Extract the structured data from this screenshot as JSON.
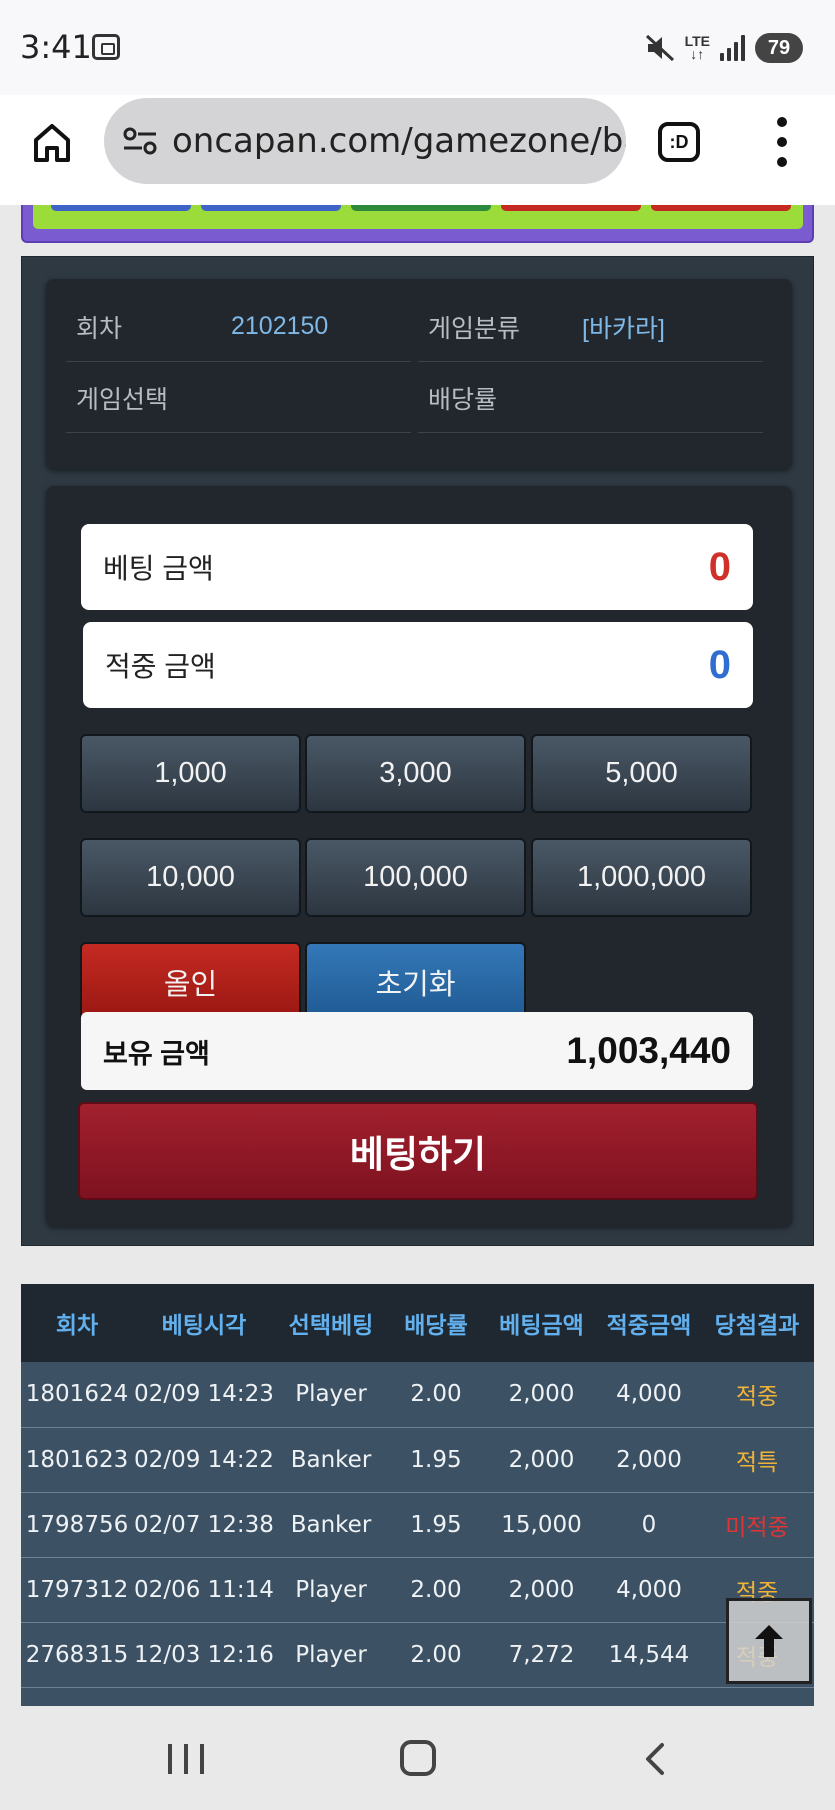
{
  "status_bar": {
    "time": "3:41",
    "battery": "79",
    "network": "LTE"
  },
  "browser": {
    "url": "oncapan.com/gamezone/ba",
    "tab_label": ":D"
  },
  "info": {
    "round_label": "회차",
    "round_value": "2102150",
    "category_label": "게임분류",
    "category_value": "[바카라]",
    "select_label": "게임선택",
    "odds_label": "배당률"
  },
  "bet": {
    "bet_amount_label": "베팅 금액",
    "bet_amount_value": "0",
    "win_amount_label": "적중 금액",
    "win_amount_value": "0",
    "chips": [
      "1,000",
      "3,000",
      "5,000",
      "10,000",
      "100,000",
      "1,000,000"
    ],
    "allin_label": "올인",
    "reset_label": "초기화",
    "balance_label": "보유 금액",
    "balance_value": "1,003,440",
    "submit_label": "베팅하기"
  },
  "history": {
    "headers": [
      "회차",
      "베팅시각",
      "선택베팅",
      "배당률",
      "베팅금액",
      "적중금액",
      "당첨결과"
    ],
    "rows": [
      [
        "1801624",
        "02/09 14:23",
        "Player",
        "2.00",
        "2,000",
        "4,000",
        "적중"
      ],
      [
        "1801623",
        "02/09 14:22",
        "Banker",
        "1.95",
        "2,000",
        "2,000",
        "적특"
      ],
      [
        "1798756",
        "02/07 12:38",
        "Banker",
        "1.95",
        "15,000",
        "0",
        "미적중"
      ],
      [
        "1797312",
        "02/06 11:14",
        "Player",
        "2.00",
        "2,000",
        "4,000",
        "적중"
      ],
      [
        "2768315",
        "12/03 12:16",
        "Player",
        "2.00",
        "7,272",
        "14,544",
        "적중"
      ]
    ]
  },
  "colors": {
    "bet_amount": "#d0302a",
    "win_amount": "#2f6ed0",
    "result_hit": "#f0b338",
    "result_miss": "#e03535",
    "header_text": "#62b0ee",
    "info_value": "#7fb8e6"
  },
  "icons": {
    "status": [
      "gallery-icon",
      "mute-icon",
      "signal-icon"
    ],
    "browser": [
      "home-icon",
      "tune-icon",
      "tab-switcher-icon",
      "more-vert-icon"
    ],
    "nav": [
      "recent-apps-icon",
      "home-nav-icon",
      "back-icon"
    ],
    "scroll": "arrow-up-icon"
  }
}
